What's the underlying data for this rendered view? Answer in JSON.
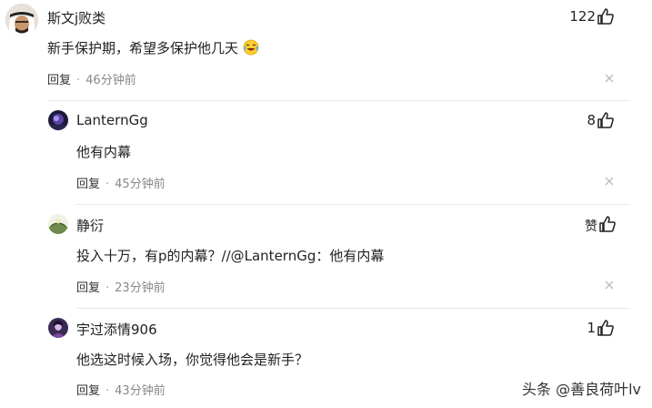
{
  "comments": [
    {
      "username": "斯文j败类",
      "content": "新手保护期，希望多保护他几天",
      "reply_label": "回复",
      "separator": "·",
      "time": "46分钟前",
      "likes": "122",
      "emoji": "crying-laughing-emoji"
    },
    {
      "username": "LanternGg",
      "content": "他有内幕",
      "reply_label": "回复",
      "separator": "·",
      "time": "45分钟前",
      "likes": "8"
    },
    {
      "username": "静衍",
      "content": "投入十万，有p的内幕？//@LanternGg：他有内幕",
      "reply_label": "回复",
      "separator": "·",
      "time": "23分钟前",
      "likes": "赞"
    },
    {
      "username": "宇过添情906",
      "content": "他选这时候入场，你觉得他会是新手？",
      "reply_label": "回复",
      "separator": "·",
      "time": "43分钟前",
      "likes": "1"
    }
  ],
  "watermark": "头条 @善良荷叶lv",
  "icons": {
    "like": "thumbs-up-icon",
    "close": "close-icon"
  },
  "colors": {
    "text": "#222222",
    "meta": "#888888",
    "divider": "#e8e8e8"
  }
}
